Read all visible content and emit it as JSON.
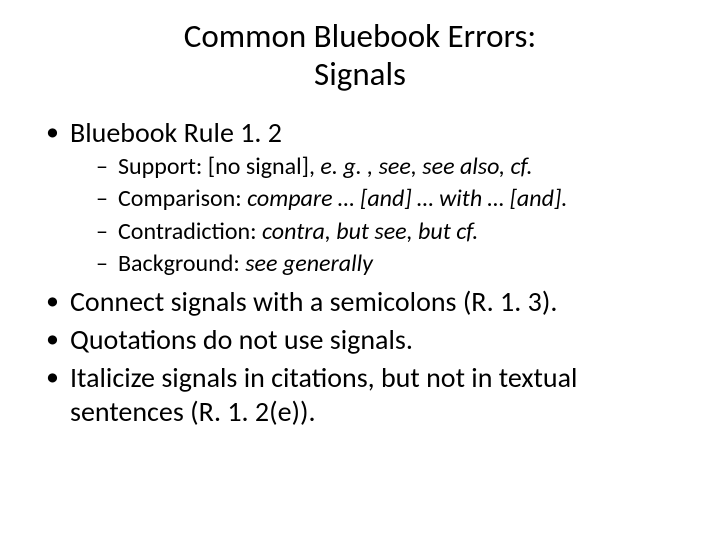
{
  "title_line1": "Common Bluebook Errors:",
  "title_line2": "Signals",
  "b1": "Bluebook Rule 1. 2",
  "s1_label": "Support: [no signal], ",
  "s1_italic": "e. g. , see, see also, cf.",
  "s2_label": "Comparison:  ",
  "s2_italic": "compare … [and] … with … [and].",
  "s3_label": "Contradiction: ",
  "s3_italic": "contra, but see, but cf.",
  "s4_label": "Background: ",
  "s4_italic": "see generally",
  "b2": "Connect signals with a semicolons (R. 1. 3).",
  "b3": "Quotations do not use signals.",
  "b4": "Italicize signals in citations, but not in textual sentences (R. 1. 2(e))."
}
